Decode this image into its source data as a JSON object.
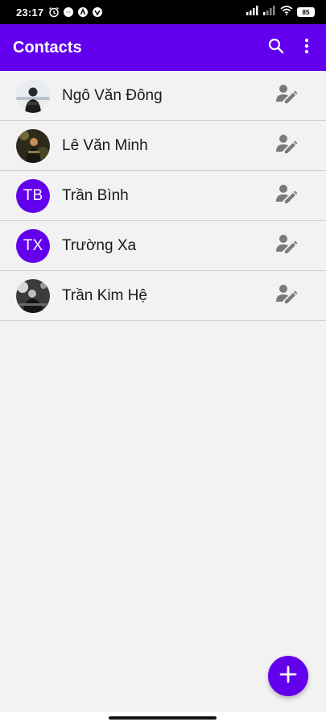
{
  "status_bar": {
    "time": "23:17",
    "battery": "85",
    "icons": [
      "alarm-icon",
      "messenger-icon",
      "app-icon",
      "vpn-icon",
      "signal-icon",
      "signal-icon",
      "wifi-icon",
      "battery-icon"
    ]
  },
  "app_bar": {
    "title": "Contacts",
    "search_icon": "search-icon",
    "more_icon": "more-vert-icon"
  },
  "contacts": [
    {
      "name": "Ngô Văn Đông",
      "initials": "",
      "avatar": "photo"
    },
    {
      "name": "Lê Văn Minh",
      "initials": "",
      "avatar": "photo"
    },
    {
      "name": "Trần Bình",
      "initials": "TB",
      "avatar": "initials"
    },
    {
      "name": "Trường Xa",
      "initials": "TX",
      "avatar": "initials"
    },
    {
      "name": "Trần Kim Hệ",
      "initials": "",
      "avatar": "photo"
    }
  ],
  "fab": {
    "icon": "plus-icon"
  },
  "colors": {
    "primary": "#6200ee",
    "status_bar": "#000000",
    "background": "#f2f2f2",
    "edit_icon": "#7a7a7a"
  }
}
